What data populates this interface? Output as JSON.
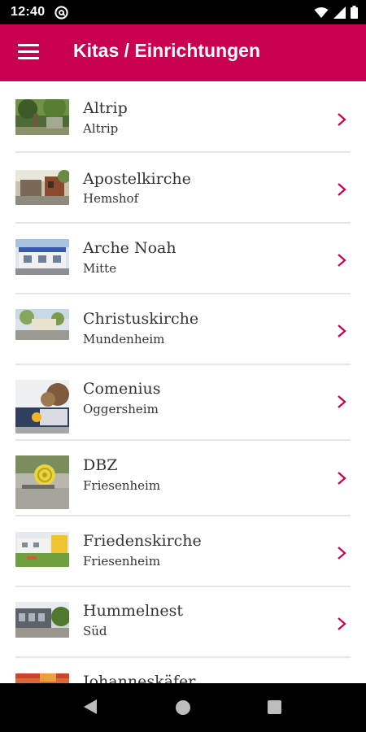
{
  "status_bar": {
    "time": "12:40"
  },
  "app_bar": {
    "title": "Kitas / Einrichtungen"
  },
  "colors": {
    "primary": "#c8004f",
    "chevron": "#c8004f"
  },
  "items": [
    {
      "title": "Altrip",
      "subtitle": "Altrip"
    },
    {
      "title": "Apostelkirche",
      "subtitle": "Hemshof"
    },
    {
      "title": "Arche Noah",
      "subtitle": "Mitte"
    },
    {
      "title": "Christuskirche",
      "subtitle": "Mundenheim"
    },
    {
      "title": "Comenius",
      "subtitle": "Oggersheim"
    },
    {
      "title": "DBZ",
      "subtitle": "Friesenheim"
    },
    {
      "title": "Friedenskirche",
      "subtitle": "Friesenheim"
    },
    {
      "title": "Hummelnest",
      "subtitle": "Süd"
    },
    {
      "title": "Johanneskäfer",
      "subtitle": ""
    }
  ]
}
